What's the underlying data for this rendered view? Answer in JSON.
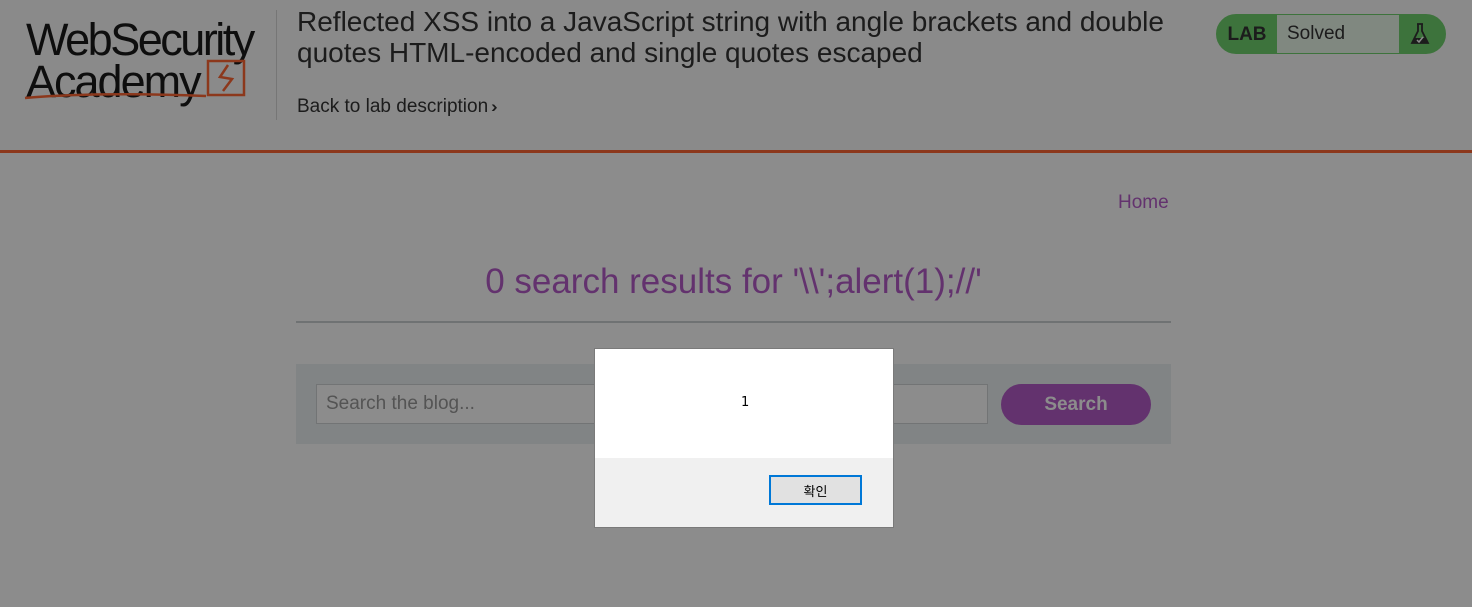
{
  "header": {
    "logo": {
      "line1": "WebSecurity",
      "line2": "Academy"
    },
    "lab_title": "Reflected XSS into a JavaScript string with angle brackets and double quotes HTML-encoded and single quotes escaped",
    "back_link": "Back to lab description",
    "lab_status": {
      "tag": "LAB",
      "status": "Solved",
      "icon": "flask-icon"
    }
  },
  "nav": {
    "home": "Home"
  },
  "results": {
    "title": "0 search results for '\\\\';alert(1);//'"
  },
  "search": {
    "placeholder": "Search the blog...",
    "value": "",
    "button": "Search"
  },
  "alert_dialog": {
    "message": "1",
    "ok_label": "확인"
  },
  "colors": {
    "accent_orange": "#ff6633",
    "link_purple": "#b45cc8",
    "status_green": "#70d16d",
    "panel_bg": "#ebf0f2"
  }
}
